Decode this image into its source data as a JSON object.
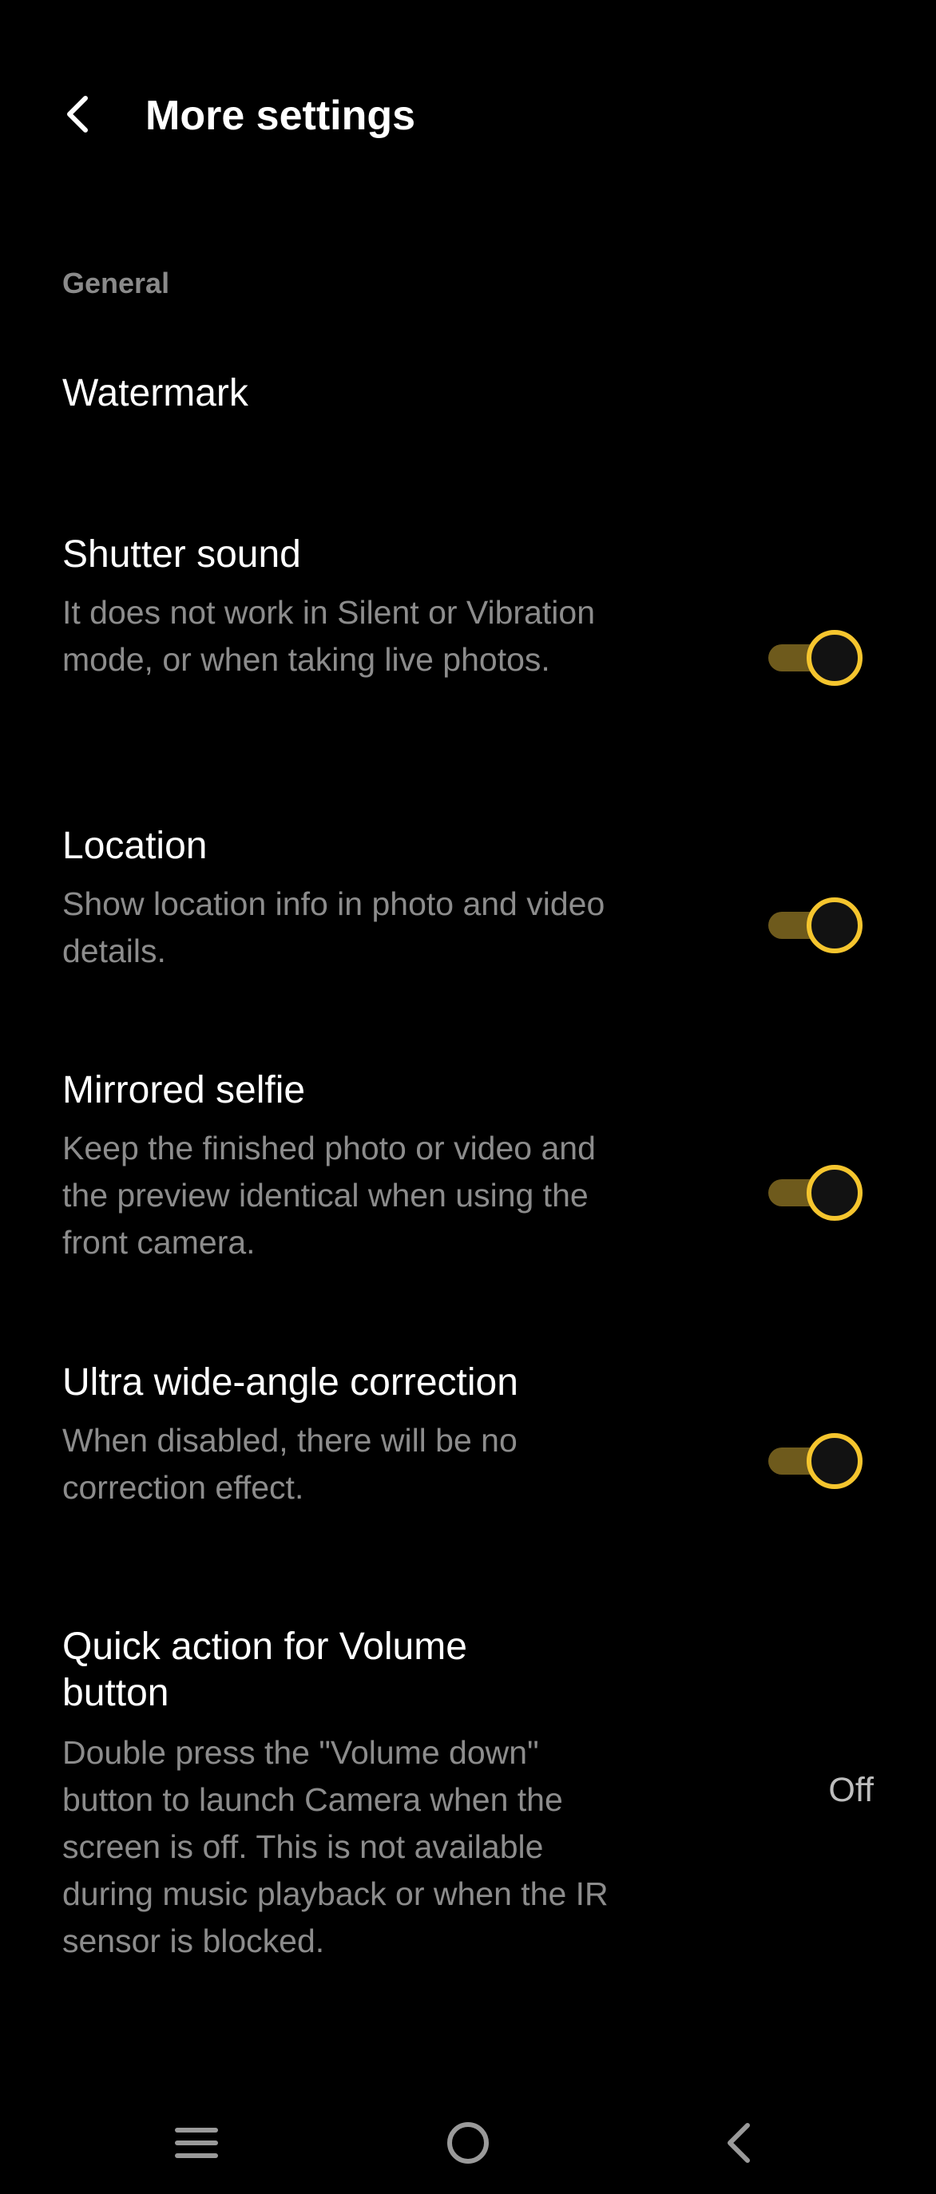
{
  "header": {
    "title": "More settings",
    "back_icon": "chevron-left-icon"
  },
  "sections": [
    {
      "label": "General",
      "items": [
        {
          "title": "Watermark",
          "description": "",
          "control": "none"
        },
        {
          "title": "Shutter sound",
          "description": "It does not work in Silent or Vibration mode, or when taking live photos.",
          "control": "toggle",
          "on": true
        },
        {
          "title": "Location",
          "description": "Show location info in photo and video details.",
          "control": "toggle",
          "on": true
        },
        {
          "title": "Mirrored selfie",
          "description": "Keep the finished photo or video and the preview identical when using the front camera.",
          "control": "toggle",
          "on": true
        },
        {
          "title": "Ultra wide-angle correction",
          "description": "When disabled, there will be no correction effect.",
          "control": "toggle",
          "on": true
        },
        {
          "title": "Quick action for Volume button",
          "description": "Double press the \"Volume down\" button to launch Camera when the screen is off. This is not available during music playback or when the IR sensor is blocked.",
          "control": "value",
          "value": "Off"
        }
      ]
    }
  ],
  "navbar": {
    "menu_icon": "menu-icon",
    "home_icon": "home-icon",
    "back_icon": "back-icon"
  },
  "colors": {
    "background": "#000000",
    "accent": "#f5c52e",
    "toggle_track": "#6e5a1c",
    "secondary_text": "#8c8c8c"
  }
}
